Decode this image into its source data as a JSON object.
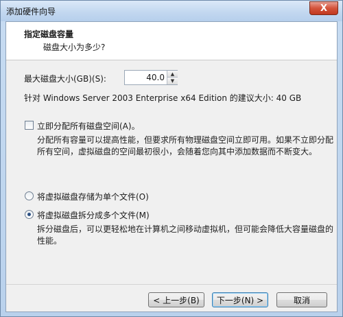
{
  "window": {
    "title": "添加硬件向导",
    "close_label": "X"
  },
  "header": {
    "title": "指定磁盘容量",
    "subtitle": "磁盘大小为多少?"
  },
  "disk": {
    "max_size_label": "最大磁盘大小(GB)(S):",
    "max_size_value": "40.0",
    "recommendation": "针对 Windows Server 2003 Enterprise x64 Edition 的建议大小: 40 GB"
  },
  "allocate": {
    "label": "立即分配所有磁盘空间(A)。",
    "checked": false,
    "description_line1": "分配所有容量可以提高性能，但要求所有物理磁盘空间立即可用。如果不立即分配",
    "description_line2": "所有空间，虚拟磁盘的空间最初很小，会随着您向其中添加数据而不断变大。"
  },
  "storage_options": [
    {
      "label": "将虚拟磁盘存储为单个文件(O)",
      "checked": false
    },
    {
      "label": "将虚拟磁盘拆分成多个文件(M)",
      "checked": true,
      "description_line1": "拆分磁盘后，可以更轻松地在计算机之间移动虚拟机，但可能会降低大容量磁盘的",
      "description_line2": "性能。"
    }
  ],
  "buttons": {
    "back": "< 上一步(B)",
    "next": "下一步(N) >",
    "cancel": "取消"
  }
}
